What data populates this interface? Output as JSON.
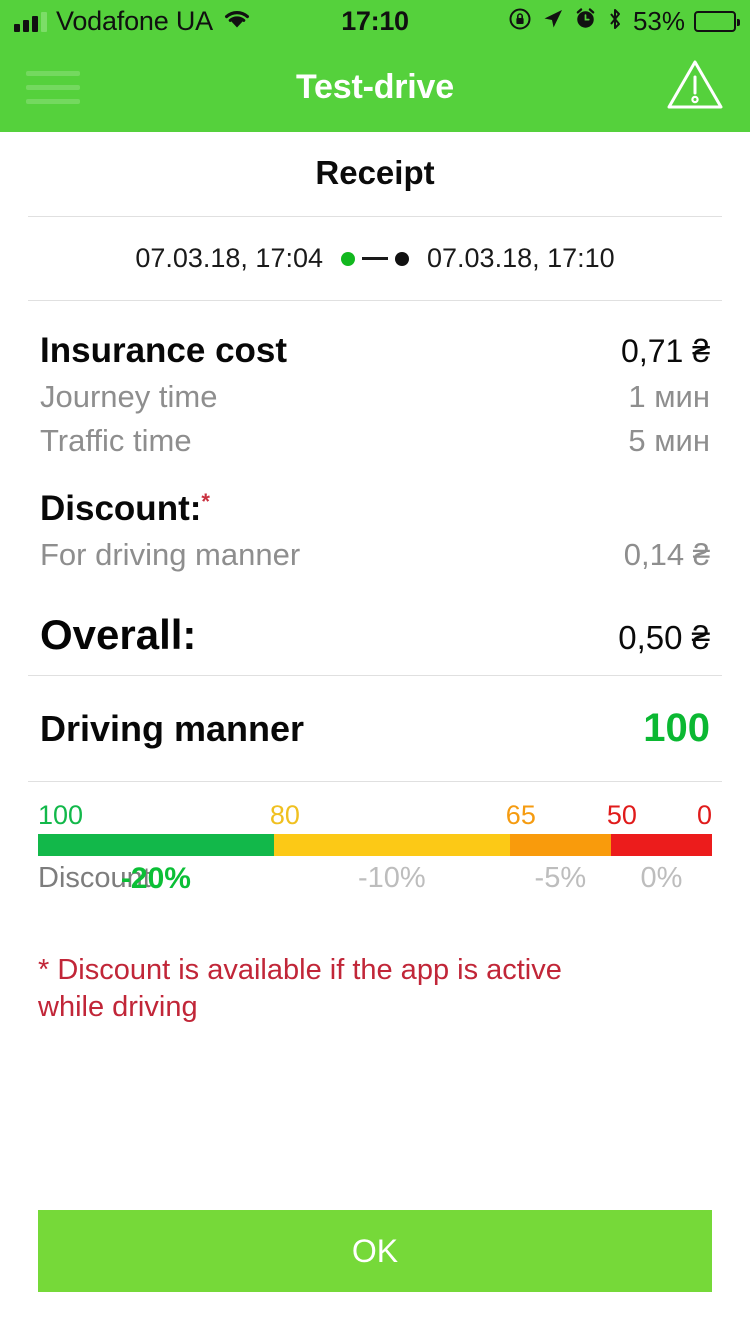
{
  "status_bar": {
    "carrier": "Vodafone UA",
    "time": "17:10",
    "battery_percent": "53%",
    "battery_level": 53,
    "icons": [
      "signal-bars-icon",
      "wifi-icon",
      "rotation-lock-icon",
      "location-arrow-icon",
      "alarm-clock-icon",
      "bluetooth-icon",
      "battery-icon"
    ]
  },
  "navbar": {
    "title": "Test-drive",
    "menu_icon": "hamburger-menu-icon",
    "warning_icon": "warning-triangle-icon"
  },
  "screen": {
    "title": "Receipt"
  },
  "date_range": {
    "start": "07.03.18, 17:04",
    "end": "07.03.18, 17:10"
  },
  "costs": {
    "insurance": {
      "label": "Insurance cost",
      "value": "0,71 ₴"
    },
    "journey_time": {
      "label": "Journey time",
      "value": "1 мин"
    },
    "traffic_time": {
      "label": "Traffic time",
      "value": "5 мин"
    }
  },
  "discount": {
    "heading": "Discount:",
    "asterisk": "*",
    "driving_manner": {
      "label": "For driving manner",
      "value": "0,14 ₴"
    }
  },
  "overall": {
    "label": "Overall:",
    "value": "0,50 ₴"
  },
  "driving_manner": {
    "label": "Driving manner",
    "score": "100"
  },
  "scale": {
    "legend_title": "Discount",
    "marks": [
      {
        "label": "100",
        "color": "#12b84a",
        "pos": 0
      },
      {
        "label": "80",
        "color": "#f0c020",
        "pos": 35
      },
      {
        "label": "65",
        "color": "#f59b10",
        "pos": 70
      },
      {
        "label": "50",
        "color": "#e01b1b",
        "pos": 85
      },
      {
        "label": "0",
        "color": "#e01b1b",
        "pos": 100
      }
    ],
    "segments": [
      {
        "color": "#12b84a",
        "width": 35
      },
      {
        "color": "#fcc916",
        "width": 35
      },
      {
        "color": "#f99b0c",
        "width": 15
      },
      {
        "color": "#ec1c1c",
        "width": 15
      }
    ],
    "discounts": [
      {
        "label": "-20%",
        "pos": 17.5,
        "active": true
      },
      {
        "label": "-10%",
        "pos": 52.5,
        "active": false
      },
      {
        "label": "-5%",
        "pos": 77.5,
        "active": false
      },
      {
        "label": "0%",
        "pos": 92.5,
        "active": false
      }
    ]
  },
  "footnote": "* Discount is available if the app is active while driving",
  "footer": {
    "ok_label": "OK"
  },
  "colors": {
    "header_green": "#55d13c",
    "button_green": "#76d939",
    "score_green": "#0bb832",
    "warning_red": "#c12638"
  }
}
